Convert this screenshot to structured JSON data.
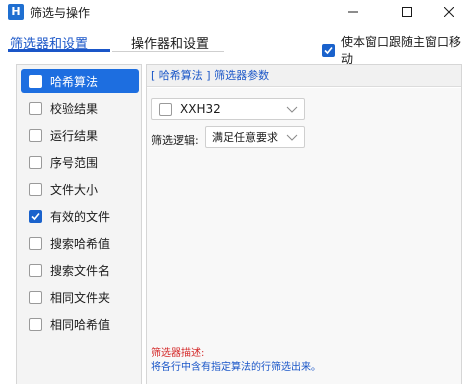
{
  "window": {
    "title": "筛选与操作",
    "icon_letter": "H"
  },
  "tabs": [
    {
      "label": "筛选器和设置",
      "active": true
    },
    {
      "label": "操作器和设置",
      "active": false
    }
  ],
  "follow_checkbox": {
    "label": "使本窗口跟随主窗口移动",
    "checked": true
  },
  "sidebar": {
    "items": [
      {
        "label": "哈希算法",
        "checked": false,
        "active": true
      },
      {
        "label": "校验结果",
        "checked": false,
        "active": false
      },
      {
        "label": "运行结果",
        "checked": false,
        "active": false
      },
      {
        "label": "序号范围",
        "checked": false,
        "active": false
      },
      {
        "label": "文件大小",
        "checked": false,
        "active": false
      },
      {
        "label": "有效的文件",
        "checked": true,
        "active": false
      },
      {
        "label": "搜索哈希值",
        "checked": false,
        "active": false
      },
      {
        "label": "搜索文件名",
        "checked": false,
        "active": false
      },
      {
        "label": "相同文件夹",
        "checked": false,
        "active": false
      },
      {
        "label": "相同哈希值",
        "checked": false,
        "active": false
      }
    ]
  },
  "panel": {
    "header": "[ 哈希算法 ] 筛选器参数",
    "algorithm_select": {
      "value": "XXH32",
      "checked": false
    },
    "logic_label": "筛选逻辑:",
    "logic_select": {
      "value": "满足任意要求"
    },
    "description_title": "筛选器描述:",
    "description_text": "将各行中含有指定算法的行筛选出来。"
  },
  "colors": {
    "accent": "#1a56c8",
    "active_item": "#1d6ee0",
    "description_title": "#d42828"
  }
}
